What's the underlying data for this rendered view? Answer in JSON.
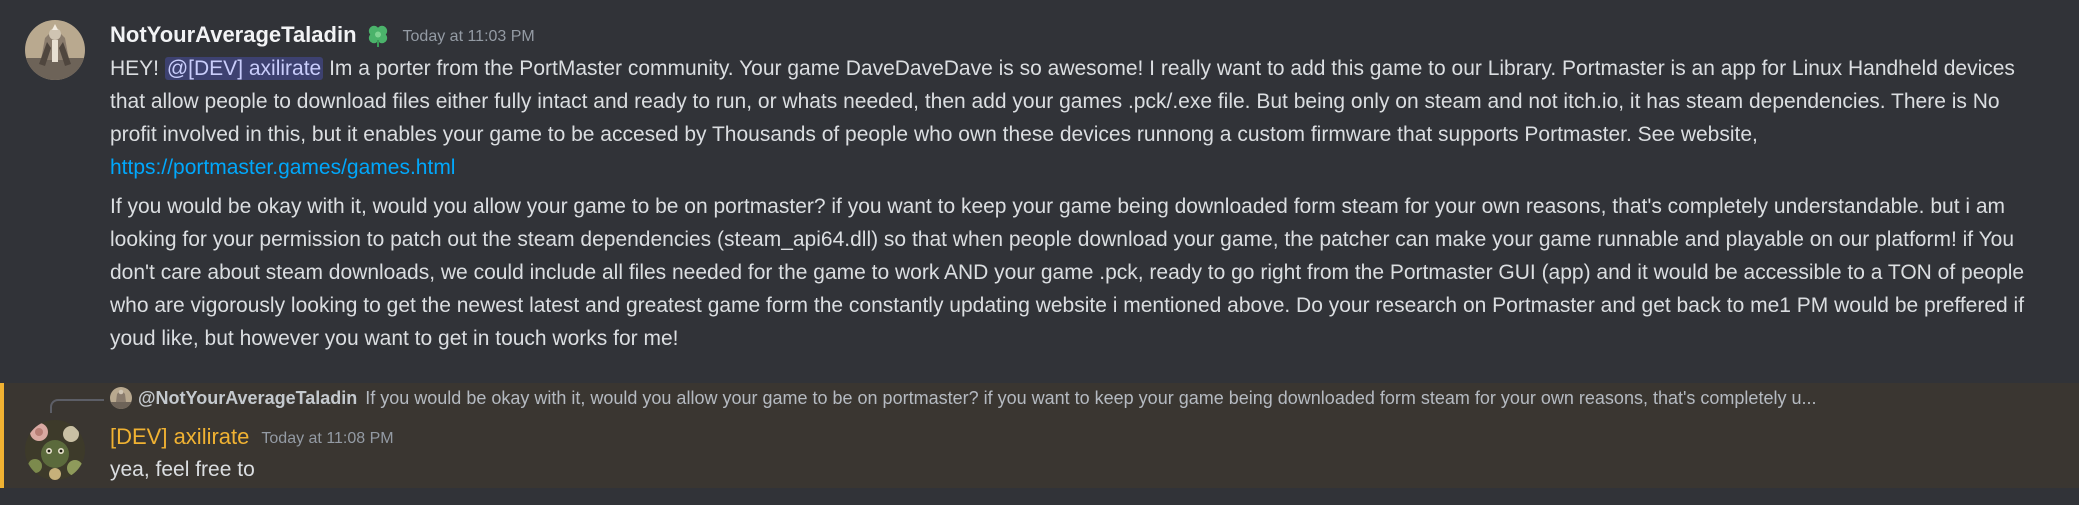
{
  "message1": {
    "author": "NotYourAverageTaladin",
    "timestamp": "Today at 11:03 PM",
    "role_icon": "clover-icon",
    "mention": "@[DEV] axilirate",
    "p1_greeting": "HEY!",
    "p1_text": "Im a porter from the PortMaster community. Your game DaveDaveDave is so awesome! I really want to add this game to our Library. Portmaster is an app for Linux Handheld devices that allow people to download files either fully intact and ready to run, or whats needed, then add your games .pck/.exe file. But being only on steam and not itch.io,  it has steam dependencies. There is No profit involved in this, but it enables your game to be accesed by Thousands of people who own these devices runnong a custom firmware that supports Portmaster. See website,",
    "p1_link": "https://portmaster.games/games.html",
    "p2_text": "If you would be okay with it, would you allow your game to be on portmaster? if you want to keep your game being downloaded form steam for your own reasons, that's completely understandable. but i am looking for your permission to patch out the steam dependencies (steam_api64.dll) so that when people download your game, the patcher can make your game runnable and playable on our platform! if You don't care about steam downloads, we could include all files needed for the game to work AND your game .pck, ready to go right from the Portmaster GUI (app) and it would be accessible to a TON of people who are vigorously looking to get the newest latest and greatest game form the constantly updating website i mentioned above. Do your research on Portmaster and get back to me1 PM would be preffered if youd like, but however you want to get in touch works for me!"
  },
  "message2": {
    "reply_author": "@NotYourAverageTaladin",
    "reply_text": "If you would be okay with it, would you allow your game to be on portmaster? if you want to keep your game being downloaded form steam for your own reasons, that's completely u...",
    "author": "[DEV] axilirate",
    "timestamp": "Today at 11:08 PM",
    "text": "yea, feel free to"
  },
  "colors": {
    "background": "#313338",
    "highlight_bg": "#3a3631",
    "highlight_bar": "#f0b232",
    "dev_name": "#f0b232",
    "link": "#00a8fc",
    "mention_bg": "#5865f2"
  }
}
